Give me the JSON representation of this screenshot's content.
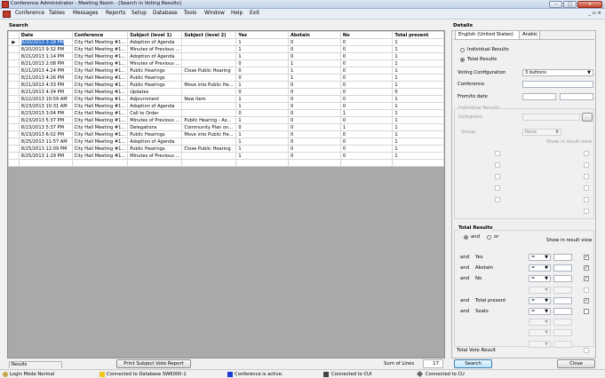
{
  "window": {
    "title": "Conference Administrator - Meeting Room - [Search in Voting Results]",
    "minimize": "–",
    "maximize": "□",
    "close": "✕"
  },
  "menu": {
    "items": [
      "Conference",
      "Tables",
      "Messages",
      "Reports",
      "Setup",
      "Database",
      "Tools",
      "Window",
      "Help",
      "Exit"
    ],
    "mdi_controls": "_ ▫ ×"
  },
  "search": {
    "section_label": "Search",
    "columns": [
      "Date",
      "Conference",
      "Subject (level 1)",
      "Subject (level 2)",
      "Yes",
      "Abstain",
      "No",
      "Total present"
    ],
    "rows": [
      [
        "8/20/2013 3:18 PM",
        "City Hall Meeting #1...",
        "Adoption of Agenda",
        "",
        "1",
        "0",
        "0",
        "1"
      ],
      [
        "8/20/2013 9:32 PM",
        "City Hall Meeting #1...",
        "Minutes of Previous ...",
        "",
        "1",
        "0",
        "0",
        "1"
      ],
      [
        "8/21/2013 1:14 PM",
        "City Hall Meeting #1...",
        "Adoption of Agenda",
        "",
        "1",
        "0",
        "0",
        "1"
      ],
      [
        "8/21/2013 2:08 PM",
        "City Hall Meeting #1...",
        "Minutes of Previous ...",
        "",
        "0",
        "1",
        "0",
        "1"
      ],
      [
        "8/21/2013 4:24 PM",
        "City Hall Meeting #1...",
        "Public Hearings",
        "Close Public Hearing",
        "0",
        "1",
        "0",
        "1"
      ],
      [
        "8/21/2013 4:26 PM",
        "City Hall Meeting #1...",
        "Public Hearings",
        "",
        "0",
        "1",
        "0",
        "1"
      ],
      [
        "8/21/2013 4:33 PM",
        "City Hall Meeting #1...",
        "Public Hearings",
        "Move into Public He...",
        "1",
        "0",
        "0",
        "1"
      ],
      [
        "8/21/2013 4:34 PM",
        "City Hall Meeting #1...",
        "Updates",
        "",
        "0",
        "0",
        "0",
        "0"
      ],
      [
        "8/22/2013 10:59 AM",
        "City Hall Meeting #1...",
        "Adjournment",
        "New item",
        "1",
        "0",
        "0",
        "1"
      ],
      [
        "8/23/2013 10:31 AM",
        "City Hall Meeting #1...",
        "Adoption of Agenda",
        "",
        "1",
        "0",
        "0",
        "1"
      ],
      [
        "8/23/2013 3:04 PM",
        "City Hall Meeting #1...",
        "Call to Order",
        "",
        "0",
        "0",
        "1",
        "1"
      ],
      [
        "8/23/2013 5:37 PM",
        "City Hall Meeting #1...",
        "Minutes of Previous ...",
        "Public Hearing - As...",
        "1",
        "0",
        "0",
        "1"
      ],
      [
        "8/23/2013 5:37 PM",
        "City Hall Meeting #1...",
        "Delegations",
        "Community Plan on...",
        "0",
        "0",
        "1",
        "1"
      ],
      [
        "8/23/2013 6:02 PM",
        "City Hall Meeting #1...",
        "Public Hearings",
        "Move into Public He...",
        "1",
        "0",
        "0",
        "1"
      ],
      [
        "8/25/2013 11:57 AM",
        "City Hall Meeting #1...",
        "Adoption of Agenda",
        "",
        "1",
        "0",
        "0",
        "1"
      ],
      [
        "8/25/2013 12:09 PM",
        "City Hall Meeting #1...",
        "Public Hearings",
        "Close Public Hearing",
        "1",
        "0",
        "0",
        "1"
      ],
      [
        "8/25/2013 1:29 PM",
        "City Hall Meeting #1...",
        "Minutes of Previous ...",
        "",
        "1",
        "0",
        "0",
        "1"
      ]
    ],
    "print_button": "Print Subject Vote Report",
    "sum_label": "Sum of Lines",
    "sum_value": "17"
  },
  "details": {
    "section_label": "Details",
    "tabs": [
      "English (United States)",
      "Arabic"
    ],
    "individual_results": "Individual Results",
    "total_results": "Total Results",
    "voting_configuration_label": "Voting Configuration",
    "voting_configuration_value": "3 buttons",
    "conference_label": "Conference",
    "from_to_date_label": "From/to date",
    "individual_results_group": "Individual Results",
    "delegates_label": "Delegates",
    "delegates_button": "...",
    "group_label": "Group",
    "group_value": "None",
    "show_in_result_view": "Show in result view",
    "total_results_group": "Total Results",
    "and_label": "and",
    "or_label": "or",
    "show_in_result_view2": "Show in result view",
    "filters": [
      {
        "conj": "and",
        "label": "Yes",
        "op": "=",
        "checked": true
      },
      {
        "conj": "and",
        "label": "Abstain",
        "op": "=",
        "checked": true
      },
      {
        "conj": "and",
        "label": "No",
        "op": "=",
        "checked": true
      },
      {
        "conj": "",
        "label": "",
        "op": "",
        "checked": false
      },
      {
        "conj": "and",
        "label": "Total present",
        "op": "=",
        "checked": true
      },
      {
        "conj": "and",
        "label": "Seats",
        "op": "=",
        "checked": false
      }
    ],
    "total_vote_result": "Total Vote Result",
    "search_button": "Search",
    "close_button": "Close"
  },
  "status": {
    "results_label": "Results",
    "login_mode": "Login Mode Normal",
    "database": "Connected to Database SW6000-1",
    "conference": "Conference is active.",
    "cui": "Connected to CUI",
    "cu": "Connected to CU"
  },
  "colors": {
    "selection": "#3170c9",
    "status_yellow": "#f0c419",
    "status_blue": "#1b3fd6"
  }
}
